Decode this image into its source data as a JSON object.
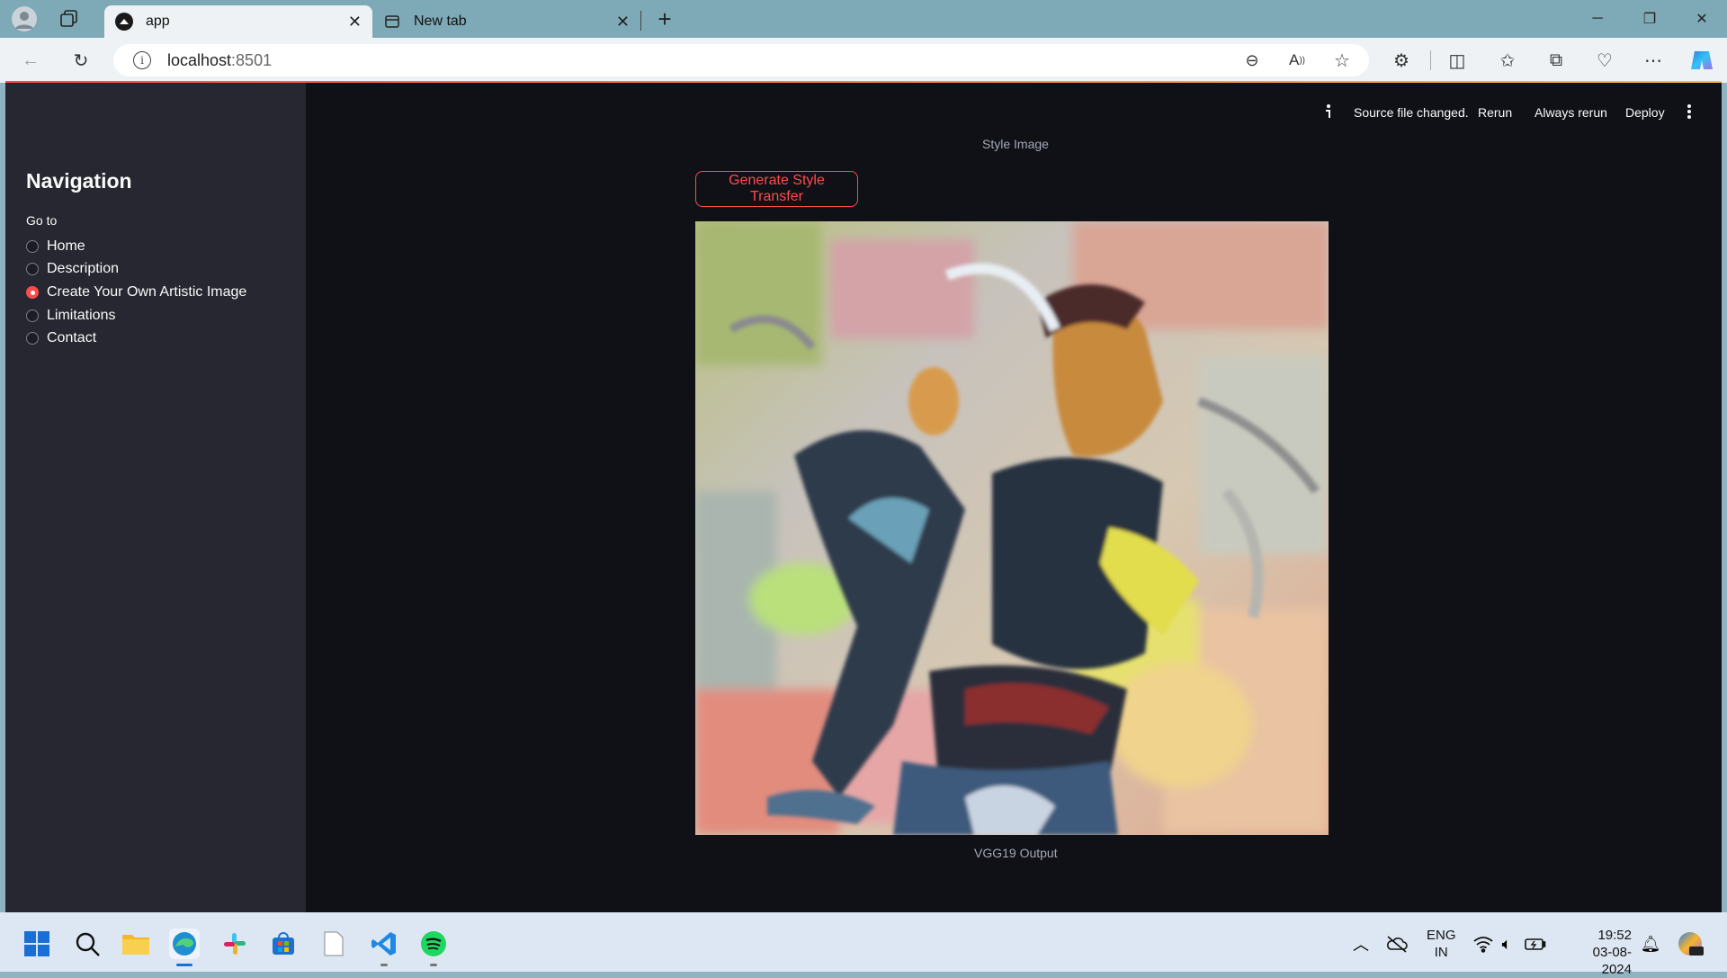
{
  "browser": {
    "tabs": [
      {
        "title": "app",
        "active": true
      },
      {
        "title": "New tab",
        "active": false
      }
    ],
    "address": {
      "host": "localhost",
      "port": ":8501"
    }
  },
  "app_header": {
    "status": "Source file changed.",
    "rerun": "Rerun",
    "always_rerun": "Always rerun",
    "deploy": "Deploy"
  },
  "sidebar": {
    "title": "Navigation",
    "group_label": "Go to",
    "options": [
      {
        "label": "Home",
        "selected": false
      },
      {
        "label": "Description",
        "selected": false
      },
      {
        "label": "Create Your Own Artistic Image",
        "selected": true
      },
      {
        "label": "Limitations",
        "selected": false
      },
      {
        "label": "Contact",
        "selected": false
      }
    ]
  },
  "main": {
    "style_caption": "Style Image",
    "generate_button": "Generate Style Transfer",
    "output_caption": "VGG19 Output"
  },
  "taskbar": {
    "lang_top": "ENG",
    "lang_bottom": "IN",
    "time": "19:52",
    "date": "03-08-2024"
  },
  "colors": {
    "accent": "#ff4b4b",
    "app_bg": "#0f1117",
    "sidebar_bg": "#262730"
  }
}
